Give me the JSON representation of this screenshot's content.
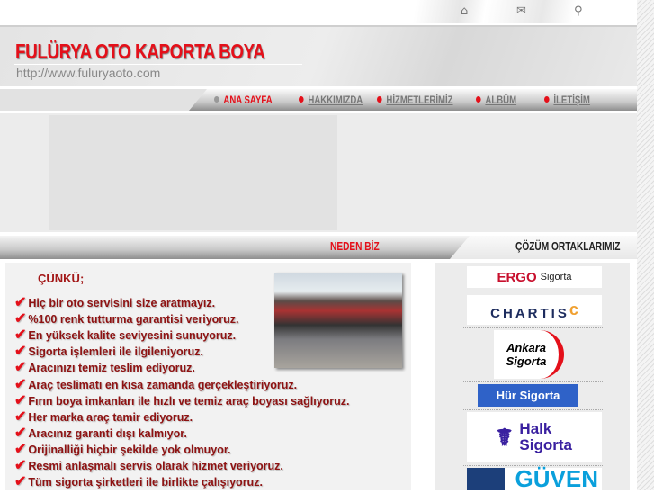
{
  "top_icons": [
    "home-icon",
    "mail-icon",
    "search-icon"
  ],
  "header": {
    "title": "FULÜRYA OTO KAPORTA BOYA",
    "url": "http://www.fuluryaoto.com"
  },
  "nav": [
    {
      "label": "ANA SAYFA",
      "active": true
    },
    {
      "label": "HAKKIMIZDA"
    },
    {
      "label": "HİZMETLERİMİZ"
    },
    {
      "label": "ALBÜM"
    },
    {
      "label": "İLETİŞİM"
    }
  ],
  "section": {
    "left_title": "NEDEN BİZ",
    "right_title": "ÇÖZÜM ORTAKLARIMIZ"
  },
  "content": {
    "heading": "ÇÜNKÜ;",
    "items": [
      "Hiç bir oto servisini size aratmayız.",
      "%100 renk tutturma garantisi veriyoruz.",
      "En yüksek kalite seviyesini sunuyoruz.",
      "Sigorta işlemleri ile ilgileniyoruz.",
      "Aracınızı temiz teslim ediyoruz.",
      "Araç teslimatı en kısa zamanda gerçekleştiriyoruz.",
      "Fırın boya imkanları ile hızlı ve temiz araç boyası sağlıyoruz.",
      "Her marka araç tamir ediyoruz.",
      "Aracınız garanti dışı kalmıyor.",
      "Orijinalliği hiçbir şekilde yok olmuyor.",
      "Resmi anlaşmalı servis olarak hizmet veriyoruz.",
      "Tüm sigorta şirketleri ile birlikte çalışıyoruz."
    ]
  },
  "partners": {
    "ergo": "ERGO",
    "ergo_sub": "Sigorta",
    "chartis": "CHARTIS",
    "ankara1": "Ankara",
    "ankara2": "Sigorta",
    "hur": "Hür Sigorta",
    "halk1": "Halk",
    "halk2": "Sigorta",
    "guven": "GÜVEN"
  },
  "colors": {
    "brand": "#e4101a"
  }
}
